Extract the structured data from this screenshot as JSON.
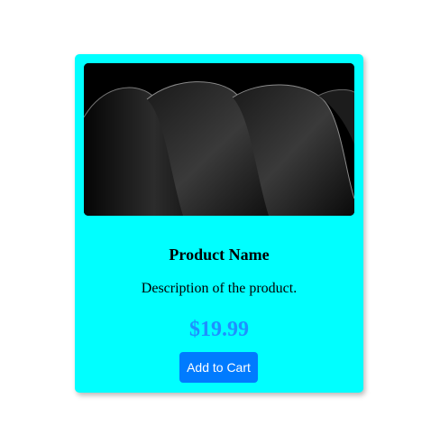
{
  "product": {
    "image_icon": "abstract-dark-waves-image",
    "name": "Product Name",
    "description": "Description of the product.",
    "price": "$19.99",
    "add_to_cart_label": "Add to Cart"
  },
  "colors": {
    "card_background": "#00ffff",
    "price": "#1e90ff",
    "button_background": "#007bff",
    "button_text": "#ffffff"
  }
}
